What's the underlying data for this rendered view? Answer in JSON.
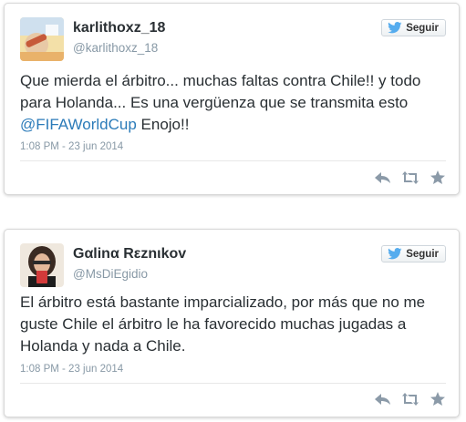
{
  "tweets": [
    {
      "name": "karlithoxz_18",
      "handle": "@karlithoxz_18",
      "follow_label": "Seguir",
      "text_before": "Que mierda el árbitro... muchas faltas contra Chile!! y todo para Holanda... Es una vergüenza que se transmita esto ",
      "text_link": "@FIFAWorldCup",
      "text_after": " Enojo!!",
      "timestamp": "1:08 PM - 23 jun 2014"
    },
    {
      "name": "Gαlіnα Rεznιkov",
      "handle": "@MsDiEgidio",
      "follow_label": "Seguir",
      "text_before": "El árbitro está bastante imparcializado, por más que no me guste Chile el árbitro le ha favorecido muchas jugadas a Holanda y nada a Chile.",
      "text_link": "",
      "text_after": "",
      "timestamp": "1:08 PM - 23 jun 2014"
    }
  ],
  "colors": {
    "link": "#2b7bb9",
    "twitter_blue": "#55acee",
    "muted": "#8899a6",
    "action_icon": "#8b9aa8"
  },
  "icons": [
    "twitter-bird-icon",
    "reply-icon",
    "retweet-icon",
    "favorite-star-icon"
  ]
}
